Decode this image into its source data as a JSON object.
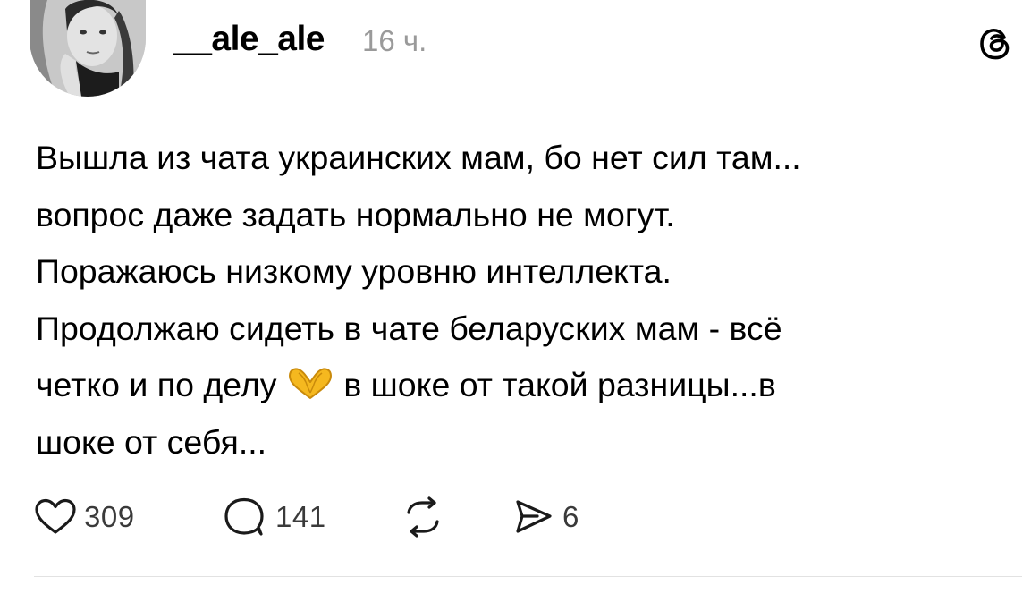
{
  "post": {
    "username": "__ale_ale",
    "timestamp": "16 ч.",
    "text_lines": [
      "Вышла из чата украинских мам, бо нет сил там...",
      "вопрос даже задать нормально не могут.",
      "Поражаюсь низкому уровню интеллекта.",
      "Продолжаю сидеть в чате беларуских мам - всё",
      "четко и по делу",
      "в шоке от такой разницы...в",
      "шоке от себя..."
    ],
    "emoji": "heart-hands-emoji"
  },
  "actions": {
    "likes": "309",
    "replies": "141",
    "shares": "6"
  },
  "icons": {
    "app": "threads-logo-icon",
    "like": "heart-icon",
    "reply": "comment-bubble-icon",
    "repost": "repost-icon",
    "share": "send-icon"
  },
  "colors": {
    "text": "#000000",
    "secondary": "#9a9a9a",
    "count": "#3a3a3a",
    "divider": "#e2e2e2",
    "emoji": "#f5b81f"
  }
}
